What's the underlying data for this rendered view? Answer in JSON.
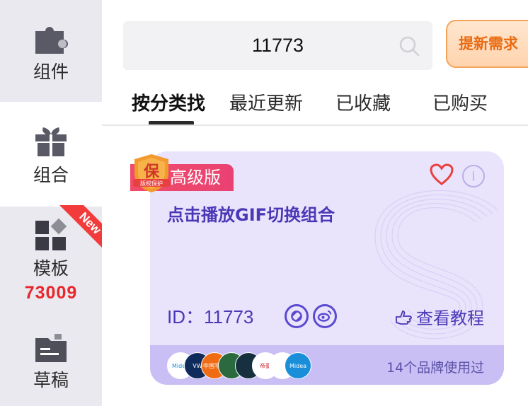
{
  "sidebar": {
    "items": [
      {
        "label": "组件",
        "icon": "puzzle-icon"
      },
      {
        "label": "组合",
        "icon": "gift-icon"
      },
      {
        "label": "模板",
        "icon": "template-grid-icon",
        "count": "73009",
        "ribbon": "New"
      },
      {
        "label": "草稿",
        "icon": "draft-folder-icon"
      }
    ],
    "active_index": 1
  },
  "search": {
    "value": "11773",
    "icon": "search-icon"
  },
  "request_button": {
    "label": "提新需求"
  },
  "tabs": [
    {
      "label": "按分类找",
      "active": true
    },
    {
      "label": "最近更新",
      "active": false
    },
    {
      "label": "已收藏",
      "active": false
    },
    {
      "label": "已购买",
      "active": false
    }
  ],
  "card": {
    "guarantee_badge": "保",
    "guarantee_sub": "版权保护",
    "tier": "高级版",
    "title": "点击播放GIF切换组合",
    "id_text": "ID：11773",
    "tutorial": "查看教程",
    "used_by": "14个品牌使用过",
    "brands": [
      {
        "text": "Midea",
        "color": "#ffffff",
        "fg": "#1a8ed8"
      },
      {
        "text": "VW",
        "color": "#0f2b5b",
        "fg": "#ffffff"
      },
      {
        "text": "中国平安",
        "color": "#ef6c15",
        "fg": "#ffffff"
      },
      {
        "text": "",
        "color": "#2a6a3e",
        "fg": "#ffffff"
      },
      {
        "text": "",
        "color": "#163040",
        "fg": "#ffffff"
      },
      {
        "text": "帝豪",
        "color": "#ffffff",
        "fg": "#c62828"
      },
      {
        "text": "",
        "color": "#ffffff",
        "fg": "#c62828"
      },
      {
        "text": "Midea",
        "color": "#1a8ed8",
        "fg": "#ffffff"
      }
    ],
    "accent": "#4a38b6",
    "heart_color": "#e8403e"
  }
}
